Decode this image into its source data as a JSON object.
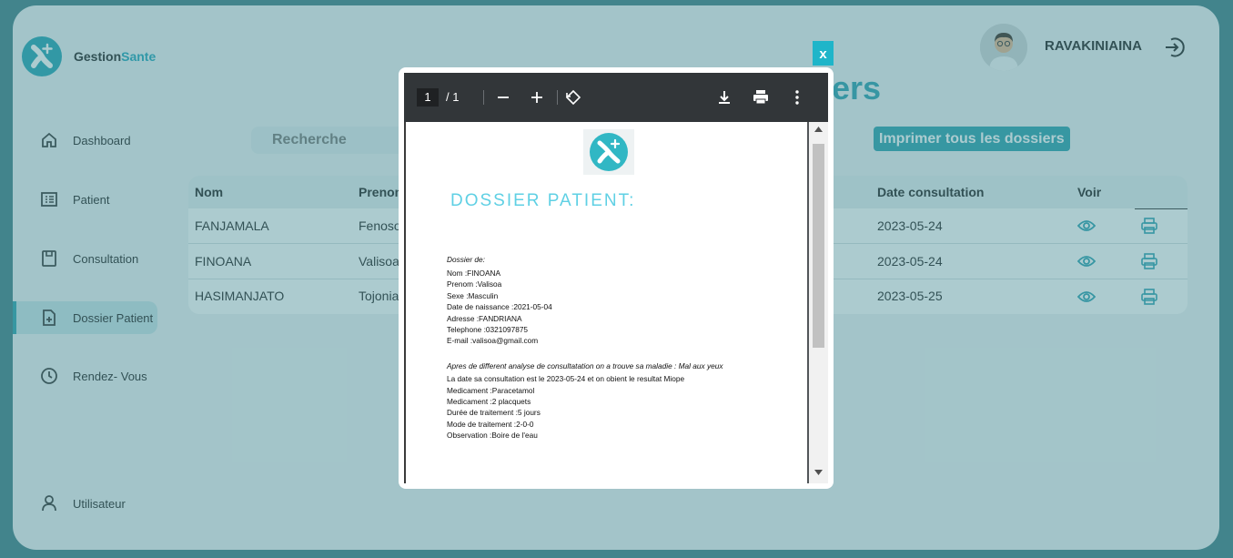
{
  "app": {
    "brand_left": "Gestion",
    "brand_right": "Sante"
  },
  "sidebar": {
    "items": [
      {
        "label": "Dashboard",
        "icon": "home-icon"
      },
      {
        "label": "Patient",
        "icon": "patient-list-icon"
      },
      {
        "label": "Consultation",
        "icon": "clipboard-icon"
      },
      {
        "label": "Dossier Patient",
        "icon": "file-add-icon",
        "active": true
      },
      {
        "label": "Rendez- Vous",
        "icon": "clock-icon"
      },
      {
        "label": "Utilisateur",
        "icon": "user-icon"
      }
    ]
  },
  "header": {
    "user_name": "RAVAKINIAINA",
    "title_fragment": "siers"
  },
  "search": {
    "placeholder": "Recherche"
  },
  "actions": {
    "print_all": "Imprimer tous les dossiers"
  },
  "table": {
    "headers": {
      "nom": "Nom",
      "prenom": "Prenom",
      "date": "Date consultation",
      "voir": "Voir"
    },
    "rows": [
      {
        "nom": "FANJAMALA",
        "prenom": "Fenoso",
        "date": "2023-05-24"
      },
      {
        "nom": "FINOANA",
        "prenom": "Valisoa",
        "date": "2023-05-24"
      },
      {
        "nom": "HASIMANJATO",
        "prenom": "Tojonia",
        "date": "2023-05-25"
      }
    ]
  },
  "modal": {
    "close_label": "x",
    "pdf": {
      "current_page": "1",
      "page_sep": "/  1"
    },
    "document": {
      "title": "DOSSIER PATIENT:",
      "lines": [
        "Dossier de:",
        "Nom :FINOANA",
        "Prenom :Valisoa",
        "Sexe :Masculin",
        "Date de naissance :2021-05-04",
        "Adresse :FANDRIANA",
        "Telephone :0321097875",
        "E-mail :valisoa@gmail.com",
        "Apres de different analyse de consultatation on a trouve sa maladie : Mal aux yeux",
        "La date sa consultation est le 2023-05-24 et on obient le resultat Miope",
        "Medicament :Paracetamol",
        "Medicament :2 placquets",
        "Durée de traitement :5 jours",
        "Mode de traitement :2-0-0",
        "Observation :Boire de l'eau"
      ]
    }
  },
  "colors": {
    "accent": "#2aa0ad",
    "title": "#5fd0e4"
  }
}
